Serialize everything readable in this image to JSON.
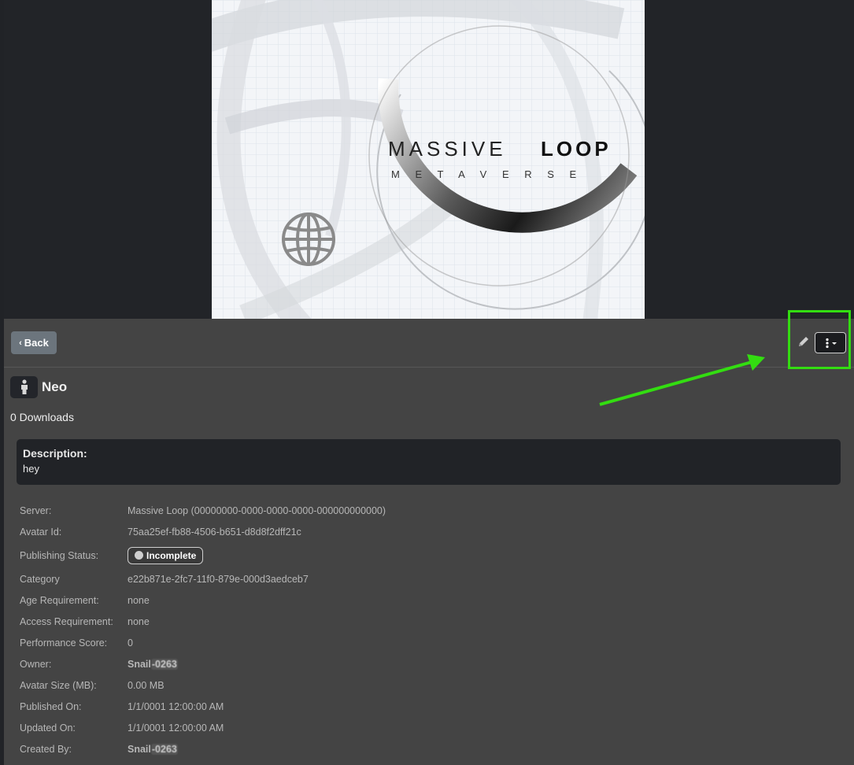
{
  "hero": {
    "brand_main": "MASSIVE",
    "brand_bold": "LOOP",
    "brand_sub": "M E T A V E R S E"
  },
  "toolbar": {
    "back_label": "Back",
    "edit_icon": "pencil-icon",
    "menu_icon": "kebab-icon"
  },
  "item": {
    "icon": "person-icon",
    "title": "Neo",
    "downloads": "0 Downloads",
    "description_label": "Description:",
    "description": "hey"
  },
  "details": {
    "server_label": "Server:",
    "server": "Massive Loop (00000000-0000-0000-0000-000000000000)",
    "avatar_id_label": "Avatar Id:",
    "avatar_id": "75aa25ef-fb88-4506-b651-d8d8f2dff21c",
    "publishing_status_label": "Publishing Status:",
    "publishing_status": "Incomplete",
    "category_label": "Category",
    "category": "e22b871e-2fc7-11f0-879e-000d3aedceb7",
    "age_label": "Age Requirement:",
    "age": "none",
    "access_label": "Access Requirement:",
    "access": "none",
    "performance_label": "Performance Score:",
    "performance": "0",
    "owner_label": "Owner:",
    "owner_name": "Snail",
    "owner_suffix": "-0263",
    "size_label": "Avatar Size (MB):",
    "size": "0.00 MB",
    "published_label": "Published On:",
    "published": "1/1/0001 12:00:00 AM",
    "updated_label": "Updated On:",
    "updated": "1/1/0001 12:00:00 AM",
    "created_by_label": "Created By:",
    "created_by_name": "Snail",
    "created_by_suffix": "-0263"
  },
  "colors": {
    "highlight": "#33dd11",
    "panel": "#444444",
    "dark": "#212327"
  }
}
